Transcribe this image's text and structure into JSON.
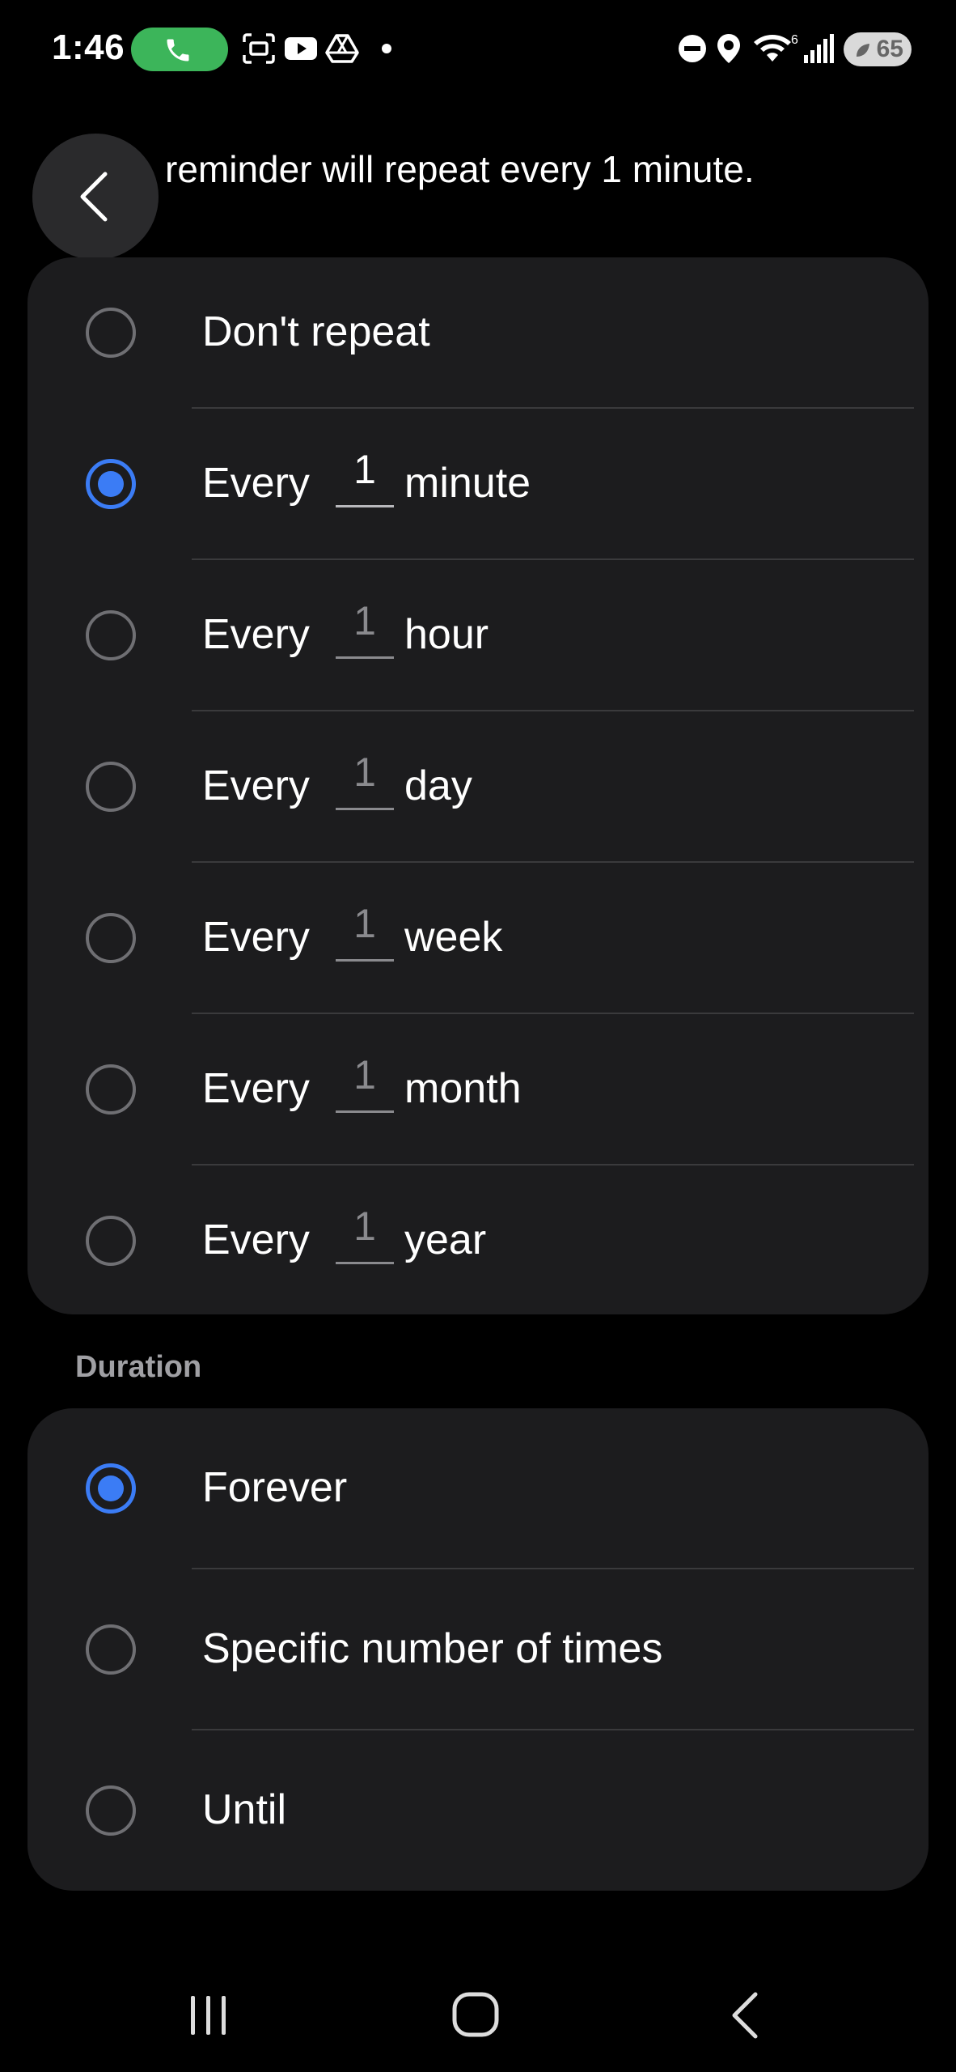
{
  "status_bar": {
    "time": "1:46",
    "battery": "65",
    "network_label": "6"
  },
  "header": {
    "summary": "reminder will repeat every 1 minute."
  },
  "repeat_options": [
    {
      "label": "Don't repeat",
      "selected": false
    },
    {
      "prefix": "Every",
      "value": "1",
      "unit": "minute",
      "selected": true
    },
    {
      "prefix": "Every",
      "value": "1",
      "unit": "hour",
      "selected": false
    },
    {
      "prefix": "Every",
      "value": "1",
      "unit": "day",
      "selected": false
    },
    {
      "prefix": "Every",
      "value": "1",
      "unit": "week",
      "selected": false
    },
    {
      "prefix": "Every",
      "value": "1",
      "unit": "month",
      "selected": false
    },
    {
      "prefix": "Every",
      "value": "1",
      "unit": "year",
      "selected": false
    }
  ],
  "duration": {
    "title": "Duration",
    "options": [
      {
        "label": "Forever",
        "selected": true
      },
      {
        "label": "Specific number of times",
        "selected": false
      },
      {
        "label": "Until",
        "selected": false
      }
    ]
  },
  "colors": {
    "accent": "#3b7cf5",
    "card": "#1c1c1e",
    "call_pill": "#3cb55a"
  },
  "icons": {
    "call": "phone-icon",
    "back": "chevron-left-icon",
    "nav": [
      "recents-icon",
      "home-icon",
      "back-icon"
    ]
  }
}
